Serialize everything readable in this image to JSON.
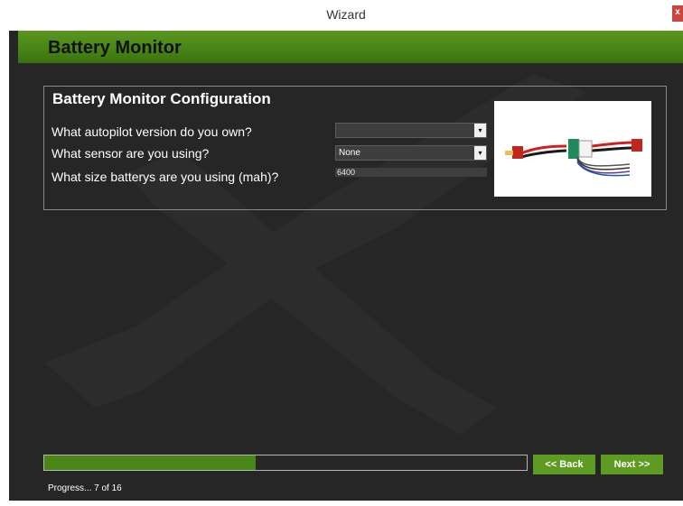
{
  "window": {
    "title": "Wizard",
    "close_glyph": "x"
  },
  "banner": {
    "title": "Battery Monitor"
  },
  "config": {
    "heading": "Battery Monitor Configuration",
    "autopilot": {
      "label": "What autopilot version do you own?",
      "value": ""
    },
    "sensor": {
      "label": "What sensor are you using?",
      "value": "None"
    },
    "battery": {
      "label": "What size batterys are you using (mah)?",
      "value": "6400"
    }
  },
  "progress": {
    "fraction": 0.4375,
    "text": "Progress... 7 of 16"
  },
  "nav": {
    "back_label": "<< Back",
    "next_label": "Next >>"
  },
  "colors": {
    "accent": "#5d9b22",
    "banner": "#4a8617",
    "background": "#262626"
  },
  "icons": {
    "combo_arrow": "▾"
  }
}
